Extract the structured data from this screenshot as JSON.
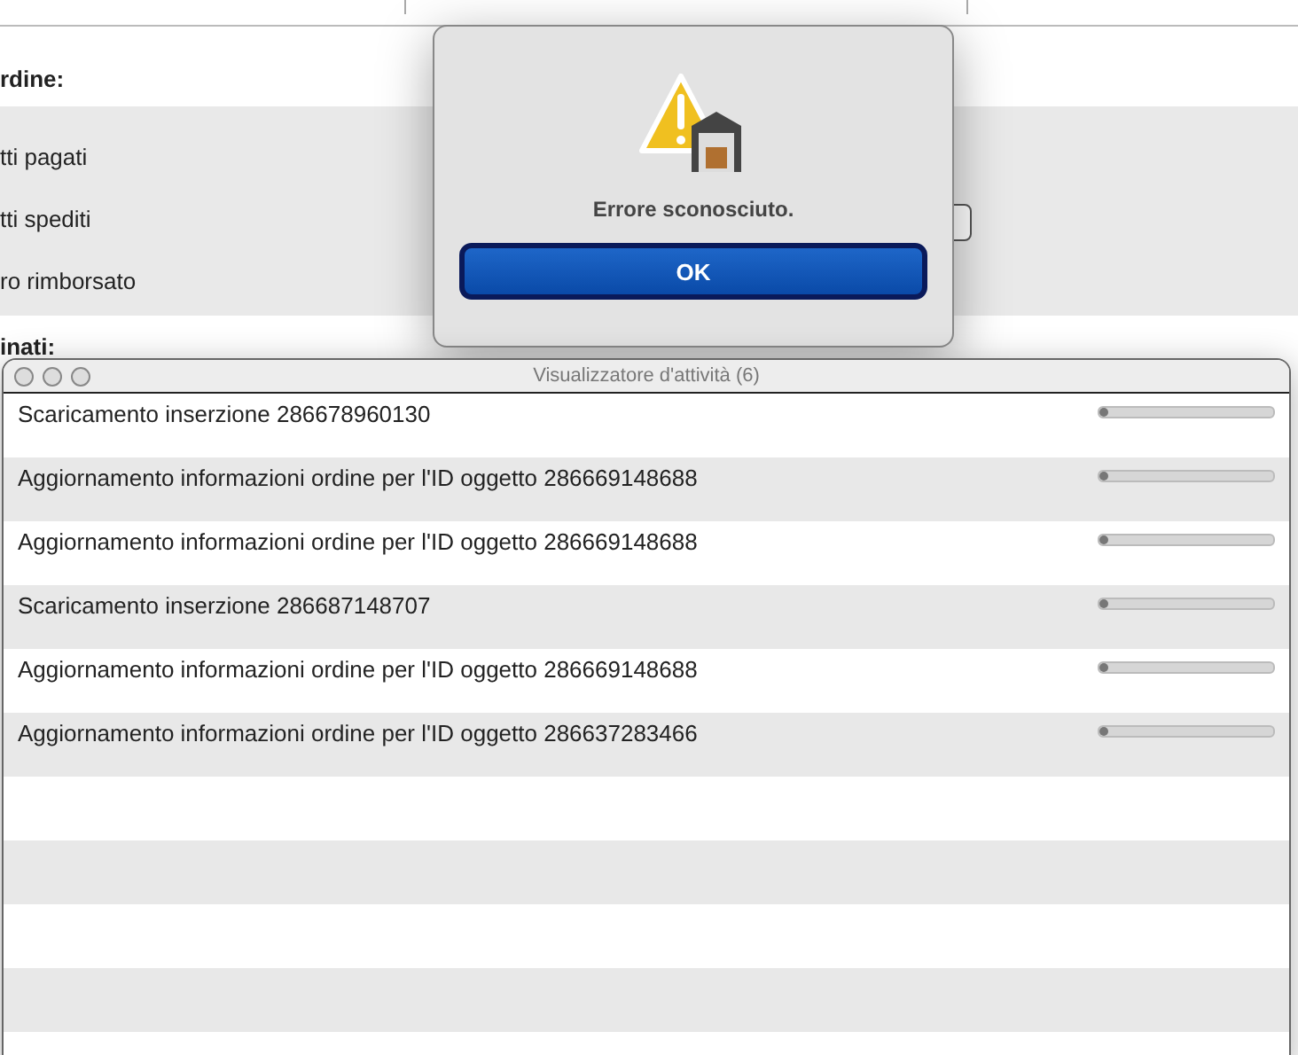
{
  "background_window": {
    "section_1_label": "rdine:",
    "options": [
      "tti pagati",
      "tti spediti",
      "ro rimborsato"
    ],
    "section_2_label": "inati:"
  },
  "alert": {
    "message": "Errore sconosciuto.",
    "button": "OK"
  },
  "activity_window": {
    "title": "Visualizzatore d'attività (6)",
    "tasks": [
      {
        "label": "Scaricamento inserzione 286678960130",
        "level": 0.03
      },
      {
        "label": "Aggiornamento informazioni ordine per l'ID oggetto 286669148688",
        "level": 0.03
      },
      {
        "label": "Aggiornamento informazioni ordine per l'ID oggetto 286669148688",
        "level": 0.03
      },
      {
        "label": "Scaricamento inserzione 286687148707",
        "level": 0.03
      },
      {
        "label": "Aggiornamento informazioni ordine per l'ID oggetto 286669148688",
        "level": 0.03
      },
      {
        "label": "Aggiornamento informazioni ordine per l'ID oggetto 286637283466",
        "level": 0.03
      }
    ]
  }
}
